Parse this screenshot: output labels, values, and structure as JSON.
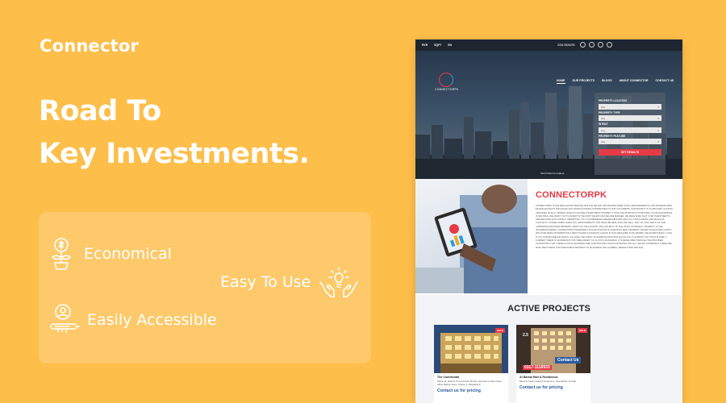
{
  "brand": "Connector",
  "headline": {
    "line1": "Road To",
    "line2": "Key Investments."
  },
  "features": [
    {
      "label": "Economical",
      "icon": "money-plant-icon"
    },
    {
      "label": "Easy To Use",
      "icon": "hands-lightbulb-icon"
    },
    {
      "label": "Easily Accessible",
      "icon": "user-key-icon"
    }
  ],
  "mock": {
    "topbar": {
      "item1": "PKR",
      "item2": "SQFT",
      "item3": "EN",
      "phone": "0334 9526290"
    },
    "logo_text": "CONNECTORPK",
    "nav": [
      "HOME",
      "OUR PROJECTS",
      "BLOGS",
      "ABOUT CONNECTOR",
      "CONTACT US"
    ],
    "search": {
      "location_label": "PROPERTY LOCATION",
      "location_value": "Any",
      "type_label": "PROPERTY TYPE",
      "type_value": "Any",
      "intent_label": "INTENT",
      "intent_value": "Any",
      "feature_label": "PROPERTY FEATURE",
      "feature_value": "Any",
      "button": "GET RESULTS"
    },
    "scroll_note": "Scroll down to explore",
    "about_title": "CONNECTORPK",
    "about_body": "CONNECTORPK IS THE REAL ESTATE SERVICE FOR THE SELLER, WE PROVIDE MORE THAN A FEW RESIDENTIAL AND BUSINESS REAL ESTATE PROJECTS AND EXCELLENT ASSETS FUNDING POSSIBILITIES TO OUR CUSTOMERS. OUR PRIORITY IS TO PROVIDE YOU WITH ADVANCED QUALITY MARKET RATE ON AN ASSET INVESTMENT POSSIBILITY WITH THE INTENTION TO PROVIDE YOU WITH EARNINGS IN MULTIPLE. WE ASSIST YOU TO INVEST IN THE MOST SAFEST AND SECURE MANNER. WE MAKE SURE THAT YOUR INVESTMENT IS SECURE FROM EACH ASPECT. PERMITTING YOU TO EXPERIENCE REMARKABLE RETURNS TO YOUR FUNDING AND PEACE OF THOUGHTS. CONNECTORPK TAKES FULL RESPONSIBILITY FOR WHAT WE DEAL WITH AND SELL. THE YOU STAY ARE IN OF THIS COMPANION AND FROM PROPERTY PARTS OF THE COUNTRY AND HAS BUILT UP THE TRUST OF PEOPLE. PROPERTY IN THE ISLAMABAD MARKET. CONNECTORPK PERFORMS A PILLAR FUNCTION IN INVESTING REAL PROPERTY MARKETS AND GIVES CLARITY WITH FINE RESULTS PERMITTING THEM TO MAKE A PLEASANT CHOICE IN THIS AREA EVEN IN ISLAMABAD. WE EXCEPTIONALLY LOOK TO US STRONG FEELING WHICH YOU HAVE THE ASSIST OF EXPERTS AND WONT ALLOW YOU TO DISRUPT ANY POINT IN TIME. A CURRENT TREND IS A MODERN IN THIS WIDE VARIETY OF FLATS IN ISLAMABAD. IT IS DEVELOPED THROUGH THE PROVIDED AUTHORITIES THAT THESE FLATS IN ISLAMABAD ARE CONSTRUCTED THROUGH PROTECTING ALL THE SET STANDARDS. THERE ARE MANY BEST AREAS FOR INVESTMENT PROPERTY IN ISLAMABAD LIKE GULBERG, BAHRIA TOWN AND DHA.",
    "projects_title": "ACTIVE PROJECTS",
    "cards": [
      {
        "badge": "SALE",
        "name": "The Continental",
        "addr": "Plaza 11, District Commercial (North) opposite to New Head office Bahria Town, Phase 4, Rawalpindi",
        "cta": "Contact us for pricing"
      },
      {
        "badge": "SALE",
        "name": "Al Barkat Mall & Residencia",
        "addr": "Block H Swan Garden Extension, Islamabad, Punjab",
        "cta": "Contact us for pricing",
        "overlay_contact": "Contact Us",
        "overlay_phone": "0317-1118933",
        "overlay_num": "2.5"
      }
    ]
  }
}
